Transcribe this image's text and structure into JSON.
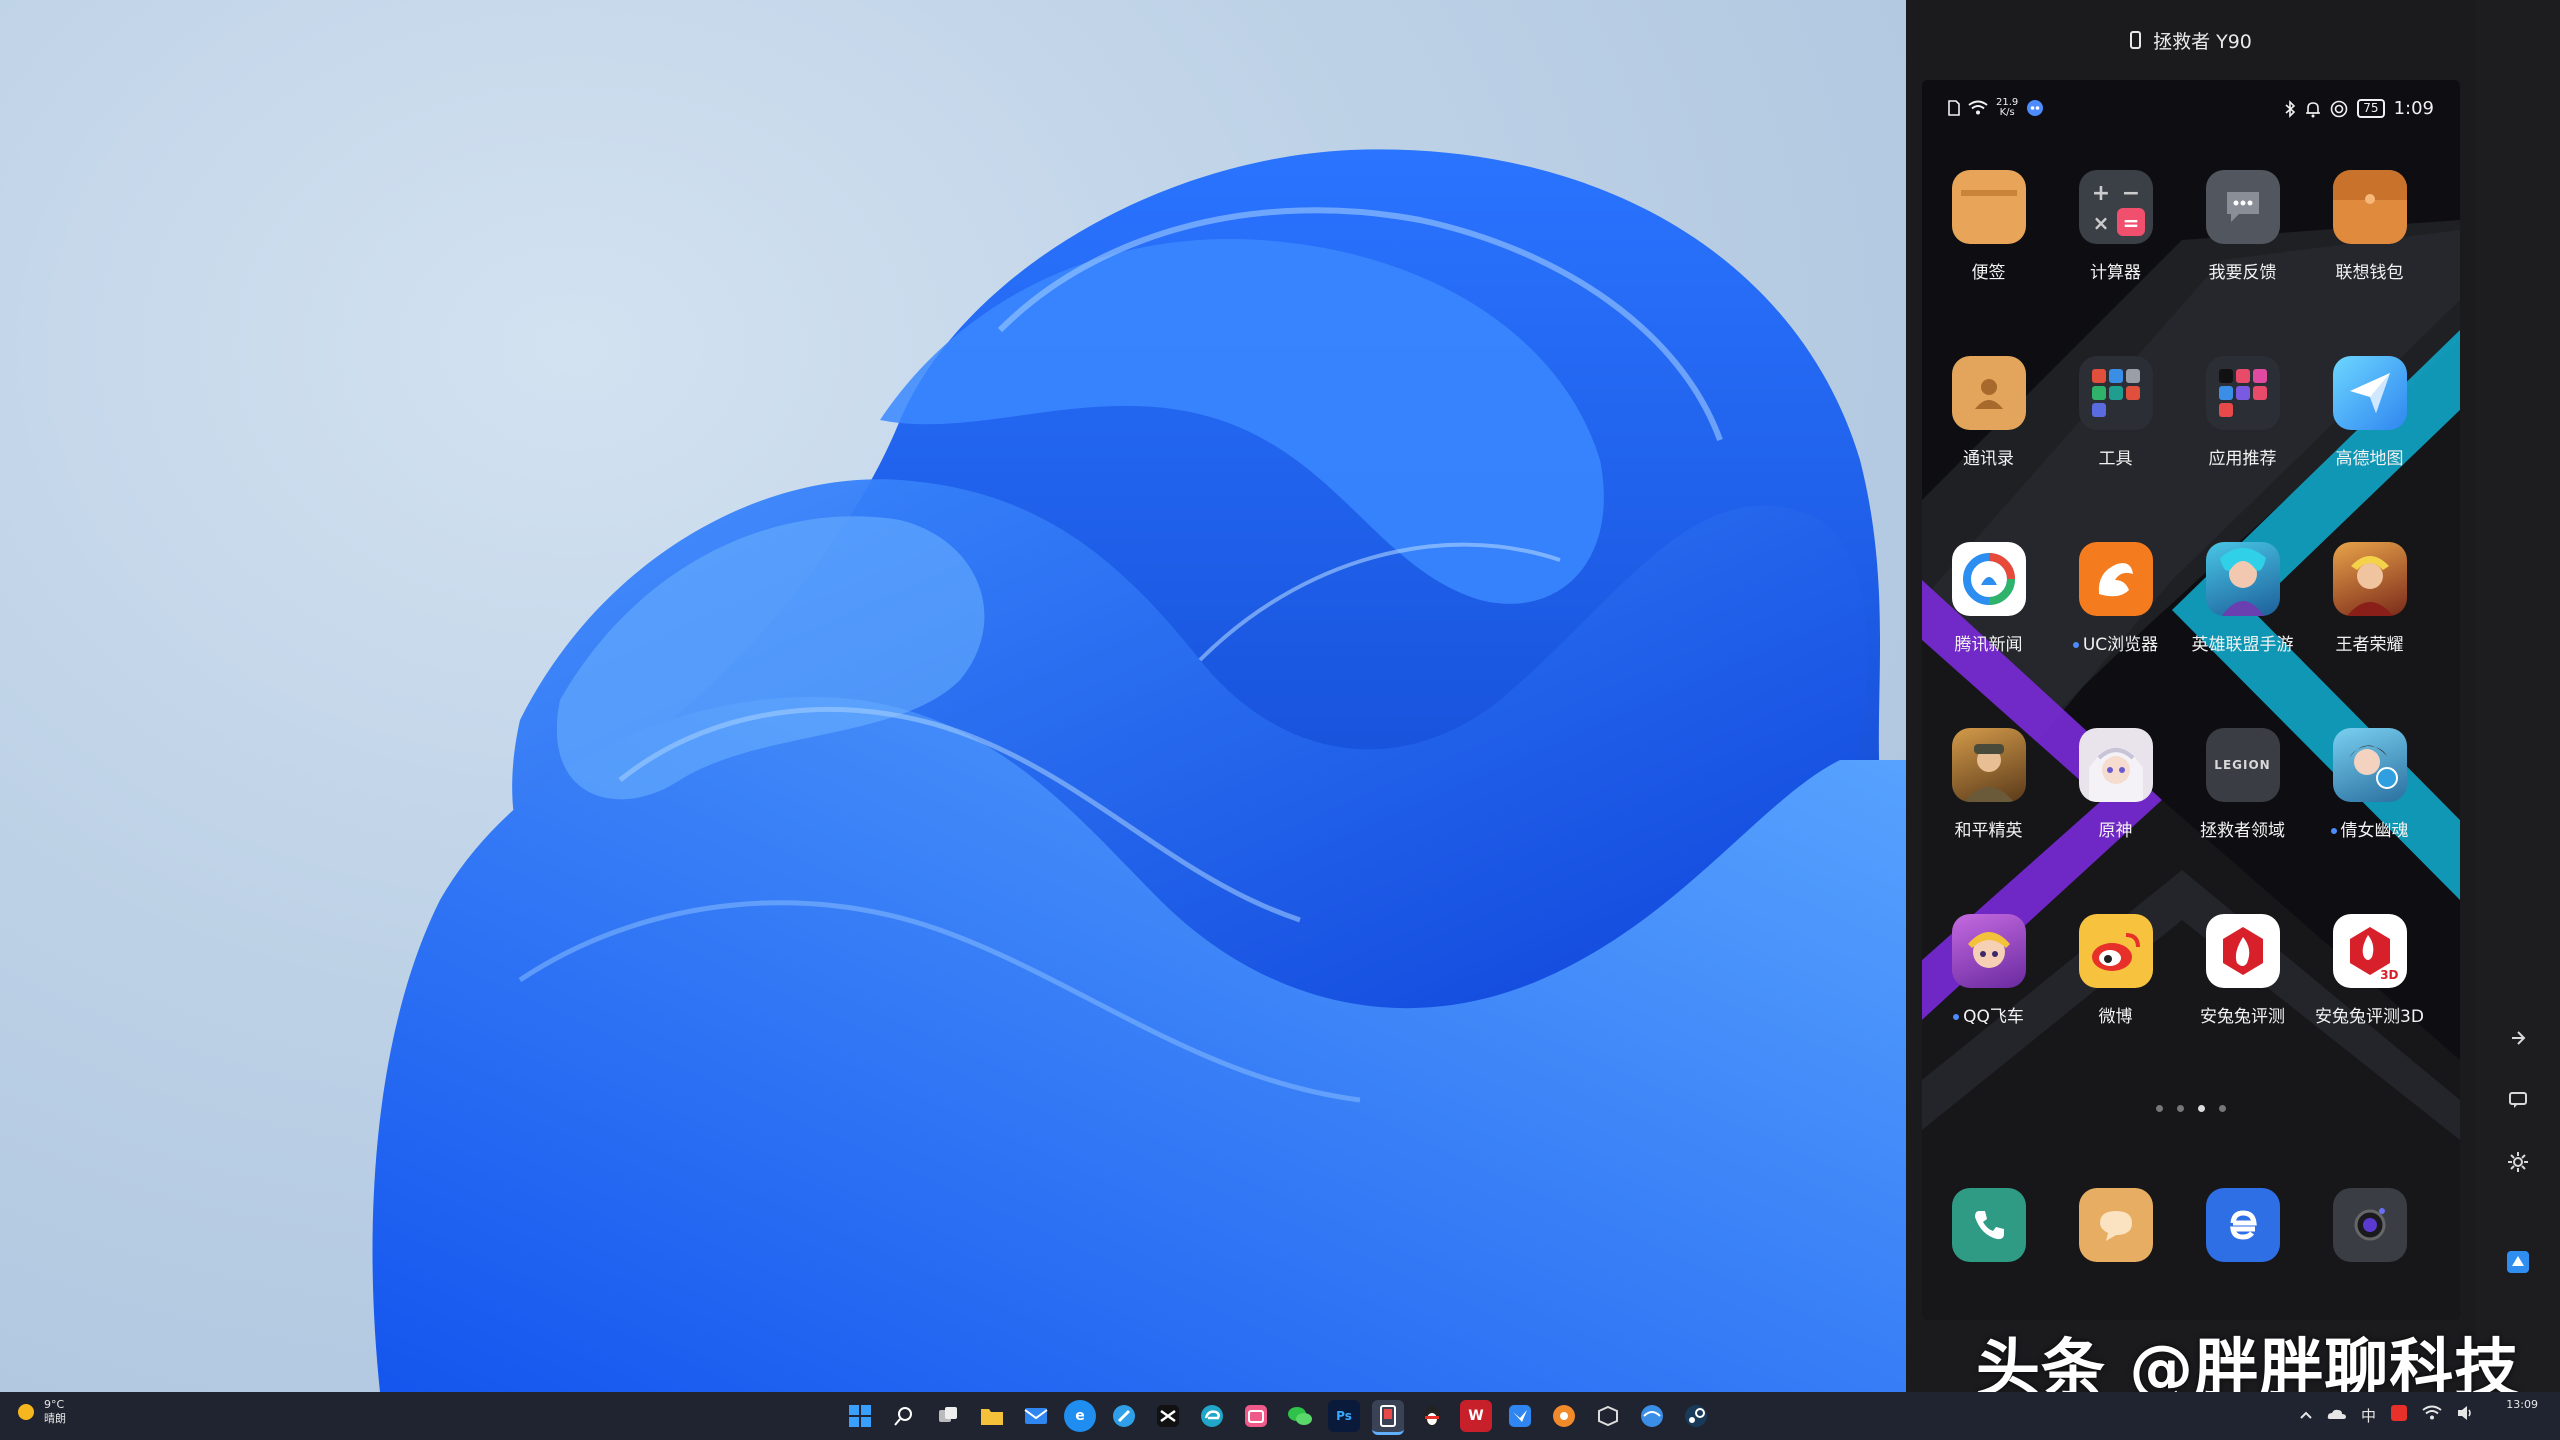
{
  "taskbar": {
    "weather_temp": "9°C",
    "weather_desc": "晴朗",
    "ime": "中",
    "clock_time": "13:09"
  },
  "phone_window": {
    "title": "拯救者 Y90"
  },
  "status_bar": {
    "net_speed_value": "21.9",
    "net_speed_unit": "K/s",
    "battery": "75",
    "time": "1:09"
  },
  "apps": [
    {
      "label": "便签",
      "color": "#e8a458",
      "dot": false
    },
    {
      "label": "计算器",
      "color": "#3b3f46",
      "dot": false
    },
    {
      "label": "我要反馈",
      "color": "#52565e",
      "dot": false
    },
    {
      "label": "联想钱包",
      "color": "#df8a3d",
      "dot": false
    },
    {
      "label": "通讯录",
      "color": "#e3a45c",
      "dot": false
    },
    {
      "label": "工具",
      "color": "#2b2e35",
      "dot": false
    },
    {
      "label": "应用推荐",
      "color": "#2b2e35",
      "dot": false
    },
    {
      "label": "高德地图",
      "color": "#3ea3f3",
      "dot": false
    },
    {
      "label": "腾讯新闻",
      "color": "#ffffff",
      "dot": false
    },
    {
      "label": "UC浏览器",
      "color": "#f47b1e",
      "dot": true
    },
    {
      "label": "英雄联盟手游",
      "color": "#2e9bc9",
      "dot": false
    },
    {
      "label": "王者荣耀",
      "color": "#b8572c",
      "dot": false
    },
    {
      "label": "和平精英",
      "color": "#a3712e",
      "dot": false
    },
    {
      "label": "原神",
      "color": "#e9e4ec",
      "dot": false
    },
    {
      "label": "拯救者领域",
      "color": "#3a3d44",
      "dot": false
    },
    {
      "label": "倩女幽魂",
      "color": "#3e9ec2",
      "dot": true
    },
    {
      "label": "QQ飞车",
      "color": "#b25acb",
      "dot": true
    },
    {
      "label": "微博",
      "color": "#f7c23e",
      "dot": false
    },
    {
      "label": "安兔兔评测",
      "color": "#ffffff",
      "dot": false
    },
    {
      "label": "安兔兔评测3D",
      "color": "#ffffff",
      "dot": false
    }
  ],
  "icons": {
    "legion_text": "LEGION",
    "antutu_3d": "3D"
  },
  "dock_apps": [
    {
      "name": "phone-app",
      "color": "#2f9b84"
    },
    {
      "name": "messages-app",
      "color": "#e7ad62"
    },
    {
      "name": "browser-app",
      "color": "#2f6fe6"
    },
    {
      "name": "camera-app",
      "color": "#3a3d44"
    }
  ],
  "watermark": "头条 @胖胖聊科技",
  "colors": {
    "taskbar_bg": "#1f2430",
    "window_bg": "#1b1b1e",
    "accent_blue": "#2f6fe6",
    "notification_dot": "#4d8cff"
  }
}
